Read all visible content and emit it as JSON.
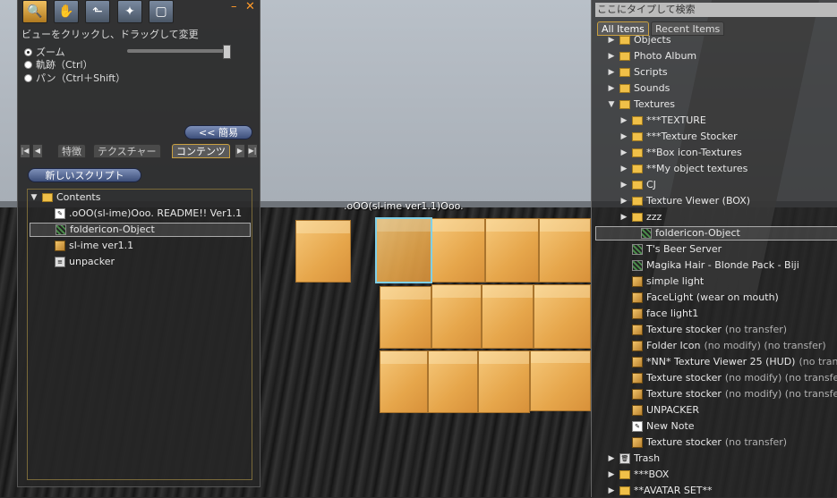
{
  "scene": {
    "floating_text": ".oOO(sl-ime ver1.1)Ooo."
  },
  "tools": {
    "buttons": [
      "magnify-icon",
      "grab-hand-icon",
      "pointer-icon",
      "magic-wand-icon",
      "land-icon"
    ],
    "minimize": "–",
    "close": "✕",
    "hint": "ビューをクリックし、ドラッグして変更",
    "radios": [
      {
        "label": "ズーム",
        "selected": true
      },
      {
        "label": "軌跡（Ctrl）",
        "selected": false
      },
      {
        "label": "パン（Ctrl＋Shift）",
        "selected": false
      }
    ],
    "simple_button": "<< 簡易",
    "tabs": [
      "特徴",
      "テクスチャー",
      "コンテンツ"
    ],
    "active_tab": "コンテンツ",
    "new_script_button": "新しいスクリプト",
    "contents": {
      "root": "Contents",
      "items": [
        {
          "icon": "note",
          "label": ".oOO(sl-ime)Ooo.  README!! Ver1.1"
        },
        {
          "icon": "texture",
          "label": "foldericon-Object",
          "selected": true
        },
        {
          "icon": "object",
          "label": "sl-ime ver1.1"
        },
        {
          "icon": "script",
          "label": "unpacker"
        }
      ]
    }
  },
  "inventory": {
    "search_placeholder": "ここにタイプして検索",
    "tabs": [
      "All Items",
      "Recent Items"
    ],
    "tree": [
      {
        "indent": 1,
        "arrow": "▶",
        "icon": "special-folder",
        "label": "Objects"
      },
      {
        "indent": 1,
        "arrow": "▶",
        "icon": "special-folder",
        "label": "Photo Album"
      },
      {
        "indent": 1,
        "arrow": "▶",
        "icon": "special-folder",
        "label": "Scripts"
      },
      {
        "indent": 1,
        "arrow": "▶",
        "icon": "special-folder",
        "label": "Sounds"
      },
      {
        "indent": 1,
        "arrow": "▼",
        "icon": "special-folder",
        "label": "Textures"
      },
      {
        "indent": 2,
        "arrow": "▶",
        "icon": "folder",
        "label": "***TEXTURE"
      },
      {
        "indent": 2,
        "arrow": "▶",
        "icon": "folder",
        "label": "***Texture Stocker"
      },
      {
        "indent": 2,
        "arrow": "▶",
        "icon": "folder",
        "label": "**Box icon-Textures"
      },
      {
        "indent": 2,
        "arrow": "▶",
        "icon": "folder",
        "label": "**My object textures"
      },
      {
        "indent": 2,
        "arrow": "▶",
        "icon": "folder",
        "label": "CJ"
      },
      {
        "indent": 2,
        "arrow": "▶",
        "icon": "folder",
        "label": "Texture Viewer (BOX)"
      },
      {
        "indent": 2,
        "arrow": "▶",
        "icon": "folder",
        "label": "zzz"
      },
      {
        "indent": 2,
        "arrow": "",
        "icon": "texture",
        "label": "foldericon-Object",
        "selected": true
      },
      {
        "indent": 2,
        "arrow": "",
        "icon": "texture",
        "label": "T's Beer Server"
      },
      {
        "indent": 2,
        "arrow": "",
        "icon": "texture",
        "label": "Magika Hair - Blonde Pack - Biji"
      },
      {
        "indent": 2,
        "arrow": "",
        "icon": "object",
        "label": "simple light"
      },
      {
        "indent": 2,
        "arrow": "",
        "icon": "object",
        "label": "FaceLight (wear on mouth)"
      },
      {
        "indent": 2,
        "arrow": "",
        "icon": "object",
        "label": "face light1"
      },
      {
        "indent": 2,
        "arrow": "",
        "icon": "object",
        "label": "Texture stocker",
        "perm": "(no transfer)"
      },
      {
        "indent": 2,
        "arrow": "",
        "icon": "object",
        "label": "Folder Icon",
        "perm": "(no modify) (no transfer)"
      },
      {
        "indent": 2,
        "arrow": "",
        "icon": "object",
        "label": "*NN* Texture Viewer 25 (HUD)",
        "perm": "(no transfer)"
      },
      {
        "indent": 2,
        "arrow": "",
        "icon": "object",
        "label": "Texture stocker",
        "perm": "(no modify) (no transfer)"
      },
      {
        "indent": 2,
        "arrow": "",
        "icon": "object",
        "label": "Texture stocker",
        "perm": "(no modify) (no transfer)"
      },
      {
        "indent": 2,
        "arrow": "",
        "icon": "object",
        "label": "UNPACKER"
      },
      {
        "indent": 2,
        "arrow": "",
        "icon": "note",
        "label": "New Note"
      },
      {
        "indent": 2,
        "arrow": "",
        "icon": "object",
        "label": "Texture stocker",
        "perm": "(no transfer)"
      },
      {
        "indent": 1,
        "arrow": "▶",
        "icon": "trash",
        "label": "Trash"
      },
      {
        "indent": 1,
        "arrow": "▶",
        "icon": "folder",
        "label": "***BOX"
      },
      {
        "indent": 1,
        "arrow": "▶",
        "icon": "folder",
        "label": "**AVATAR SET**"
      }
    ]
  }
}
